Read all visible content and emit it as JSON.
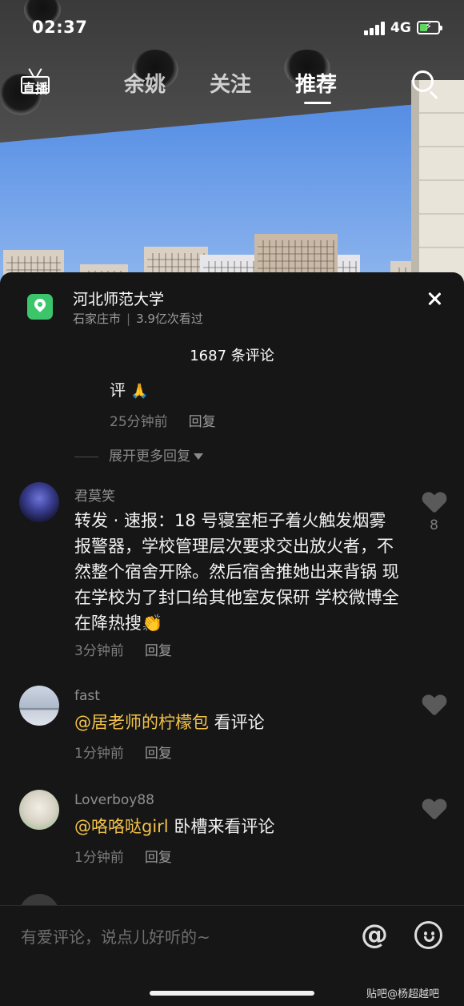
{
  "status_bar": {
    "time": "02:37",
    "network": "4G",
    "battery_level": 0.45
  },
  "top_nav": {
    "live_label": "直播",
    "tabs": [
      {
        "label": "余姚",
        "active": false
      },
      {
        "label": "关注",
        "active": false
      },
      {
        "label": "推荐",
        "active": true
      }
    ],
    "search_icon": "search-icon"
  },
  "location": {
    "title": "河北师范大学",
    "city": "石家庄市",
    "views": "3.9亿次看过",
    "icon": "location-pin-icon"
  },
  "comments_header": {
    "count_text": "1687 条评论"
  },
  "previous_reply": {
    "text": "评",
    "emoji": "🙏",
    "time": "25分钟前",
    "reply_label": "回复"
  },
  "expand_more": {
    "label": "展开更多回复"
  },
  "comments": [
    {
      "username": "君莫笑",
      "text": "转发 · 速报：18 号寝室柜子着火触发烟雾报警器，学校管理层次要求交出放火者，不然整个宿舍开除。然后宿舍推她出来背锅 现在学校为了封口给其他室友保研 学校微博全在降热搜",
      "emoji": "👏",
      "time": "3分钟前",
      "reply_label": "回复",
      "likes": "8"
    },
    {
      "username": "fast",
      "mention": "@居老师的柠檬包",
      "text": " 看评论",
      "time": "1分钟前",
      "reply_label": "回复"
    },
    {
      "username": "Loverboy88",
      "mention": "@咯咯哒girl",
      "text": " 卧槽来看评论",
      "time": "1分钟前",
      "reply_label": "回复"
    }
  ],
  "input_bar": {
    "placeholder": "有爱评论，说点儿好听的~",
    "at_icon": "@",
    "emoji_icon": "smile-icon"
  },
  "watermark": "贴吧@杨超越吧"
}
